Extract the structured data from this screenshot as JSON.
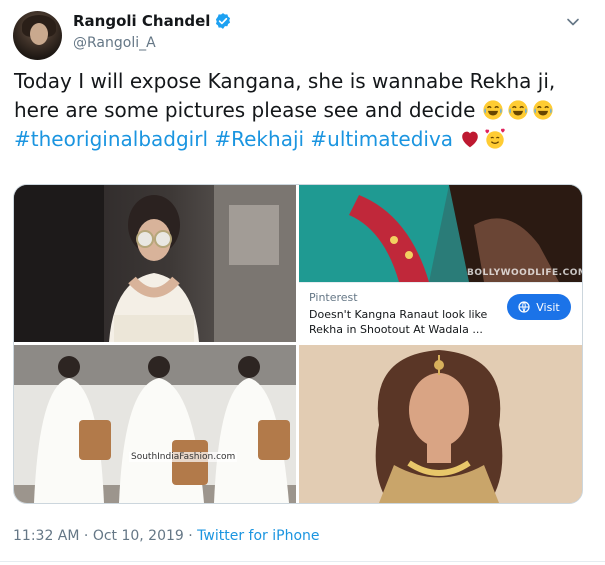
{
  "author": {
    "name": "Rangoli Chandel",
    "handle": "@Rangoli_A",
    "verified": true
  },
  "tweet": {
    "text_line": "Today I will expose Kangana, she is wannabe Rekha ji, here are some pictures please see and decide",
    "hashtags": [
      "#theoriginalbadgirl",
      "#Rekhaji",
      "#ultimatediva"
    ],
    "emojis_after_text": [
      "face-with-tears-of-joy",
      "face-with-tears-of-joy",
      "face-with-tears-of-joy"
    ],
    "emojis_after_tags": [
      "red-heart",
      "smiling-face-with-hearts"
    ]
  },
  "media": {
    "photo2_watermark": "BOLLYWOODLIFE.COM",
    "photo3_watermark": "SouthIndiaFashion.com",
    "pinterest_card": {
      "source": "Pinterest",
      "title": "Doesn't Kangna Ranaut look like Rekha in Shootout At Wadala ...",
      "button": "Visit"
    }
  },
  "meta": {
    "time": "11:32 AM",
    "sep1": " · ",
    "date": "Oct 10, 2019",
    "sep2": " · ",
    "source": "Twitter for iPhone"
  },
  "colors": {
    "link": "#1b95e0",
    "muted": "#657786",
    "border": "#ccd6dd",
    "visit_button": "#1b73e8"
  }
}
